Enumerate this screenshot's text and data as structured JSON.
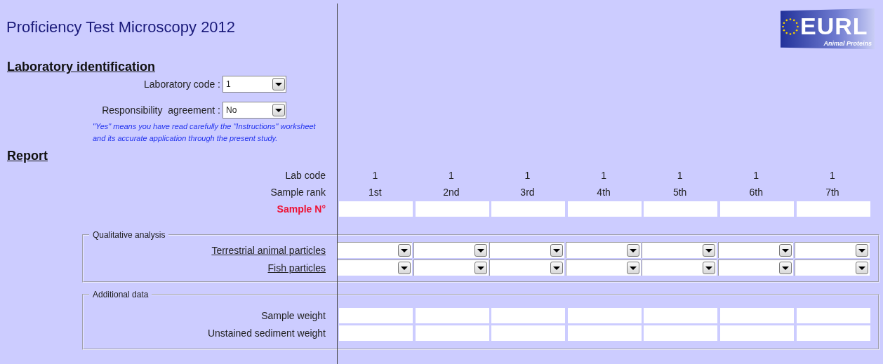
{
  "title": "Proficiency Test Microscopy 2012",
  "logo": {
    "text": "EURL",
    "subtitle": "Animal Proteins"
  },
  "laboratory_identification": {
    "heading": "Laboratory identification",
    "fields": [
      {
        "label": "Laboratory code :",
        "value": "1"
      },
      {
        "label": "Responsibility  agreement :",
        "value": "No"
      }
    ],
    "note": "\"Yes\" means you have read carefully the \"Instructions\" worksheet and its accurate application through the present study."
  },
  "report": {
    "heading": "Report",
    "lab_code_label": "Lab code",
    "sample_rank_label": "Sample rank",
    "sample_no_label": "Sample N°",
    "samples": [
      {
        "lab_code": "1",
        "rank": "1st"
      },
      {
        "lab_code": "1",
        "rank": "2nd"
      },
      {
        "lab_code": "1",
        "rank": "3rd"
      },
      {
        "lab_code": "1",
        "rank": "4th"
      },
      {
        "lab_code": "1",
        "rank": "5th"
      },
      {
        "lab_code": "1",
        "rank": "6th"
      },
      {
        "lab_code": "1",
        "rank": "7th"
      }
    ],
    "qualitative": {
      "legend": "Qualitative analysis",
      "rows": [
        "Terrestrial animal particles",
        "Fish particles"
      ]
    },
    "additional": {
      "legend": "Additional data",
      "rows": [
        "Sample weight",
        "Unstained sediment weight"
      ]
    }
  }
}
